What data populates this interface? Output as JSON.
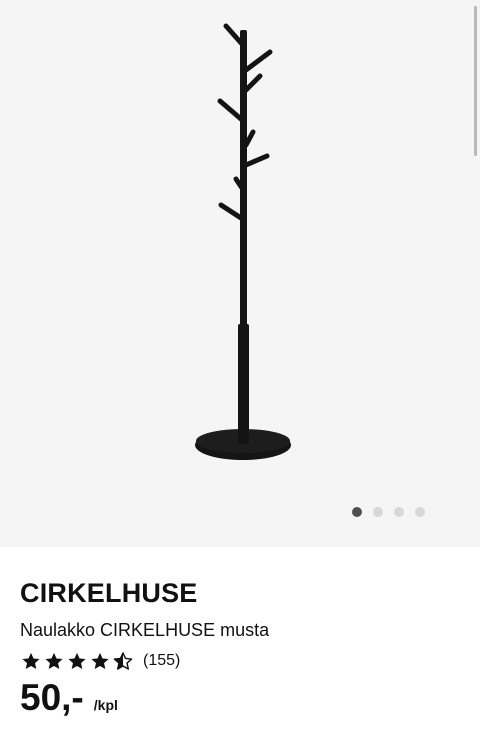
{
  "product": {
    "image_icon": "coat-stand-image",
    "carousel": {
      "total_images": 4,
      "active_index": 0
    },
    "name": "CIRKELHUSE",
    "description": "Naulakko CIRKELHUSE musta",
    "rating": {
      "value": 4.5,
      "max": 5,
      "count_label": "(155)"
    },
    "price": {
      "amount": "50,-",
      "unit": "/kpl"
    }
  },
  "colors": {
    "image_background": "#f5f5f5",
    "text": "#111111",
    "dot_active": "#4f4f4f",
    "dot_inactive": "#d7d7d7"
  }
}
